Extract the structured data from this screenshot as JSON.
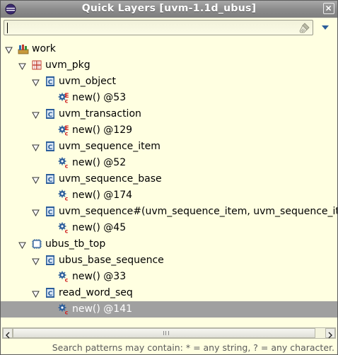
{
  "window": {
    "title": "Quick Layers [uvm-1.1d_ubus]"
  },
  "filter": {
    "value": "",
    "placeholder": ""
  },
  "tree": {
    "rows": [
      {
        "label": "work",
        "icon": "project-library-icon",
        "level": 0,
        "expanded": true
      },
      {
        "label": "uvm_pkg",
        "icon": "package-icon",
        "level": 1,
        "expanded": true
      },
      {
        "label": "uvm_object",
        "icon": "class-icon",
        "level": 2,
        "expanded": true
      },
      {
        "label": "new() @53",
        "icon": "external-function-icon",
        "level": 3,
        "expanded": null
      },
      {
        "label": "uvm_transaction",
        "icon": "class-icon",
        "level": 2,
        "expanded": true
      },
      {
        "label": "new() @129",
        "icon": "external-function-icon",
        "level": 3,
        "expanded": null
      },
      {
        "label": "uvm_sequence_item",
        "icon": "class-icon",
        "level": 2,
        "expanded": true
      },
      {
        "label": "new() @52",
        "icon": "function-icon",
        "level": 3,
        "expanded": null
      },
      {
        "label": "uvm_sequence_base",
        "icon": "class-icon",
        "level": 2,
        "expanded": true
      },
      {
        "label": "new() @174",
        "icon": "function-icon",
        "level": 3,
        "expanded": null
      },
      {
        "label": "uvm_sequence#(uvm_sequence_item, uvm_sequence_item)",
        "icon": "class-icon",
        "level": 2,
        "expanded": true
      },
      {
        "label": "new() @45",
        "icon": "function-icon",
        "level": 3,
        "expanded": null
      },
      {
        "label": "ubus_tb_top",
        "icon": "module-icon",
        "level": 1,
        "expanded": true
      },
      {
        "label": "ubus_base_sequence",
        "icon": "class-icon",
        "level": 2,
        "expanded": true
      },
      {
        "label": "new() @33",
        "icon": "function-icon",
        "level": 3,
        "expanded": null
      },
      {
        "label": "read_word_seq",
        "icon": "class-icon",
        "level": 2,
        "expanded": true
      },
      {
        "label": "new() @141",
        "icon": "function-icon",
        "level": 3,
        "expanded": null,
        "selected": true
      }
    ]
  },
  "status": {
    "hint": "Search patterns may contain: * = any string, ? = any character."
  },
  "colors": {
    "background": "#ffffe1",
    "selection": "#a0a0a0",
    "class_blue": "#2b5d9a"
  }
}
